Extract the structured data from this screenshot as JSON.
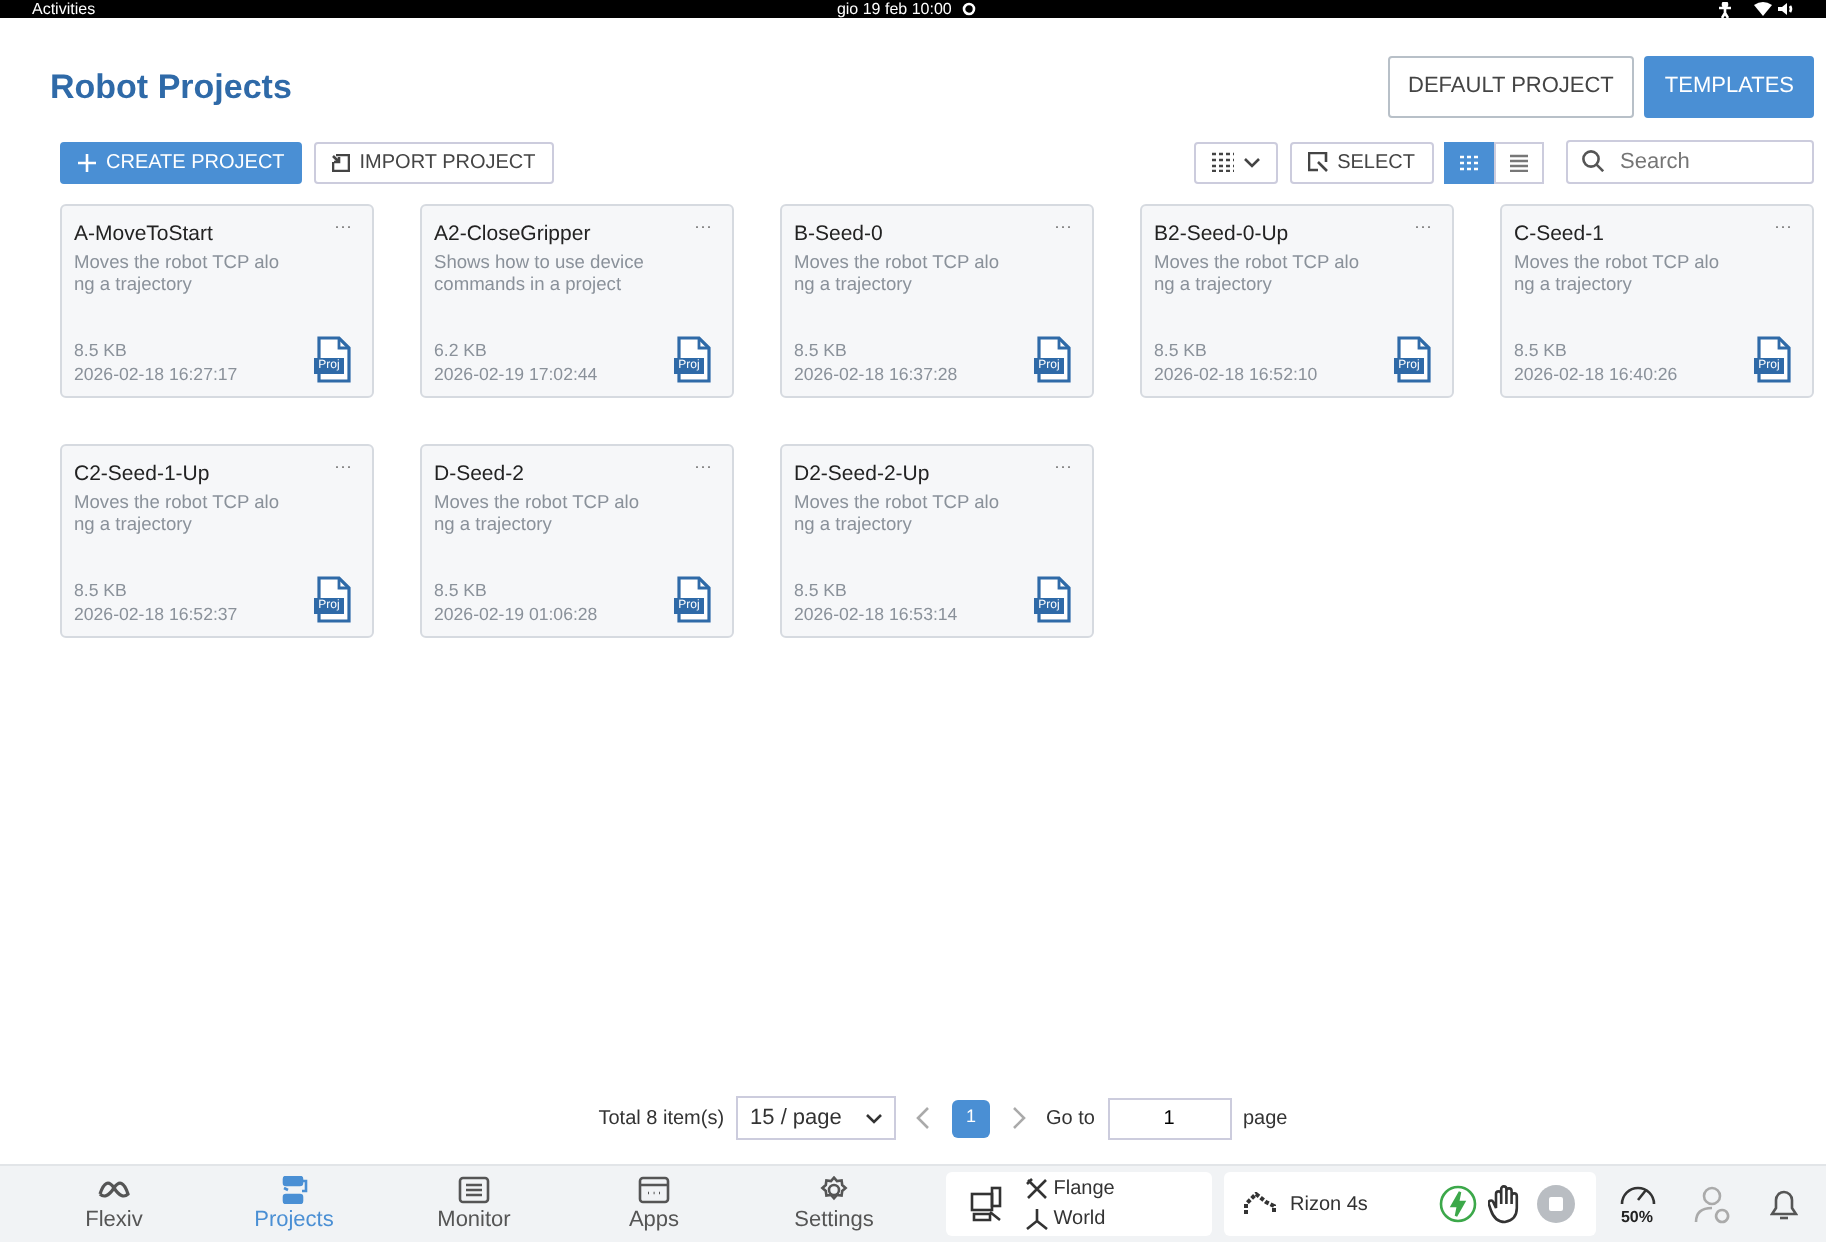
{
  "system_bar": {
    "activities": "Activities",
    "clock": "gio 19 feb  10:00"
  },
  "header": {
    "title": "Robot Projects",
    "buttons": [
      {
        "label": "DEFAULT PROJECT",
        "kind": "outline"
      },
      {
        "label": "TEMPLATES",
        "kind": "primary"
      }
    ]
  },
  "toolbar": {
    "create": "CREATE PROJECT",
    "import": "IMPORT PROJECT",
    "select": "SELECT",
    "views": [
      {
        "kind": "grid",
        "selected": true
      },
      {
        "kind": "list",
        "selected": false
      }
    ],
    "search": {
      "placeholder": "Search"
    }
  },
  "projects": [
    {
      "name": "A-MoveToStart",
      "description": "Moves the robot TCP along a trajectory",
      "size": "8.5 KB",
      "date": "2026-02-18 16:27:17",
      "menu": "···",
      "badge": "Proj"
    },
    {
      "name": "A2-CloseGripper",
      "description": "Shows how to use device commands in a project",
      "size": "6.2 KB",
      "date": "2026-02-19 17:02:44",
      "menu": "···",
      "badge": "Proj"
    },
    {
      "name": "B-Seed-0",
      "description": "Moves the robot TCP along a trajectory",
      "size": "8.5 KB",
      "date": "2026-02-18 16:37:28",
      "menu": "···",
      "badge": "Proj"
    },
    {
      "name": "B2-Seed-0-Up",
      "description": "Moves the robot TCP along a trajectory",
      "size": "8.5 KB",
      "date": "2026-02-18 16:52:10",
      "menu": "···",
      "badge": "Proj"
    },
    {
      "name": "C-Seed-1",
      "description": "Moves the robot TCP along a trajectory",
      "size": "8.5 KB",
      "date": "2026-02-18 16:40:26",
      "menu": "···",
      "badge": "Proj"
    },
    {
      "name": "C2-Seed-1-Up",
      "description": "Moves the robot TCP along a trajectory",
      "size": "8.5 KB",
      "date": "2026-02-18 16:52:37",
      "menu": "···",
      "badge": "Proj"
    },
    {
      "name": "D-Seed-2",
      "description": "Moves the robot TCP along a trajectory",
      "size": "8.5 KB",
      "date": "2026-02-19 01:06:28",
      "menu": "···",
      "badge": "Proj"
    },
    {
      "name": "D2-Seed-2-Up",
      "description": "Moves the robot TCP along a trajectory",
      "size": "8.5 KB",
      "date": "2026-02-18 16:53:14",
      "menu": "···",
      "badge": "Proj"
    }
  ],
  "pagination": {
    "total": "Total 8 item(s)",
    "page_size": "15 / page",
    "pages": [
      {
        "label": "1",
        "selected": true
      }
    ],
    "goto_label": "Go to",
    "goto_value": "1",
    "page_label": "page"
  },
  "bottom_nav": [
    {
      "label": "Flexiv",
      "kind": "logo",
      "selected": false
    },
    {
      "label": "Projects",
      "kind": "projects",
      "selected": true
    },
    {
      "label": "Monitor",
      "kind": "monitor",
      "selected": false
    },
    {
      "label": "Apps",
      "kind": "apps",
      "selected": false
    },
    {
      "label": "Settings",
      "kind": "settings",
      "selected": false
    }
  ],
  "status": {
    "tool": "Flange",
    "frame": "World",
    "robot": "Rizon 4s",
    "speed": "50%"
  }
}
